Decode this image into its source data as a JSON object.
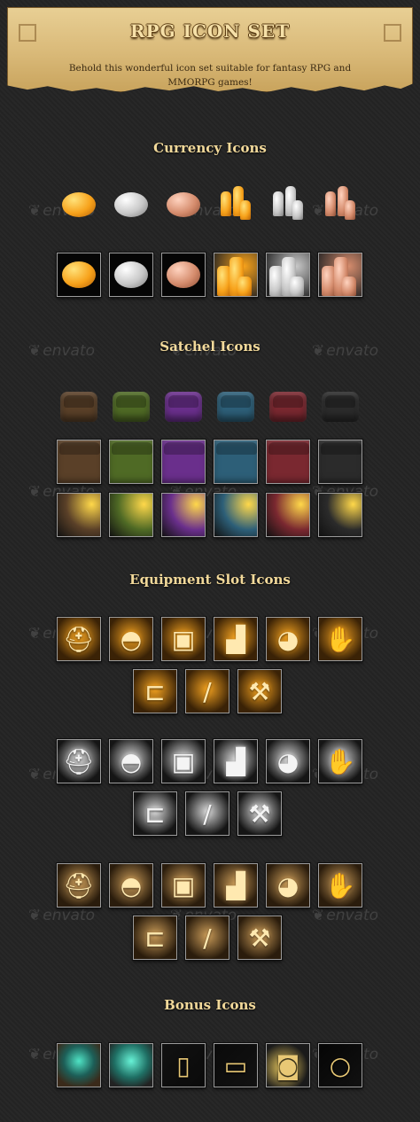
{
  "header": {
    "title": "RPG ICON SET",
    "subtitle": "Behold this wonderful icon set suitable for fantasy RPG and MMORPG games!"
  },
  "watermark": "envato",
  "sections": {
    "currency": "Currency Icons",
    "satchel": "Satchel Icons",
    "equipment": "Equipment Slot Icons",
    "bonus": "Bonus Icons"
  },
  "colors": {
    "gold": "#f7a21b",
    "silver": "#c8c8c8",
    "copper": "#d58c6d",
    "bag_brown": "#5a4028",
    "bag_green": "#4f6a25",
    "bag_purple": "#6a2f8c",
    "bag_teal": "#2d5f78",
    "bag_red": "#7a2830",
    "bag_black": "#2b2b2b",
    "equip_gold": "#f0a020",
    "equip_silver": "#d8d8d8",
    "equip_bronze": "#c89a58"
  },
  "icons": {
    "currency_free": [
      "gold-coin-icon",
      "silver-coin-icon",
      "copper-coin-icon",
      "gold-stack-icon",
      "silver-stack-icon",
      "copper-stack-icon"
    ],
    "equipment": [
      "helmet-icon",
      "cap-icon",
      "chest-armor-icon",
      "boots-icon",
      "shoulder-armor-icon",
      "gauntlet-icon",
      "bracer-icon",
      "sword-icon",
      "axe-icon"
    ],
    "bonus": [
      "spellbook-icon",
      "spellbook-open-icon",
      "scroll-icon",
      "scroll-open-icon",
      "ring-icon",
      "ring-small-icon"
    ]
  }
}
